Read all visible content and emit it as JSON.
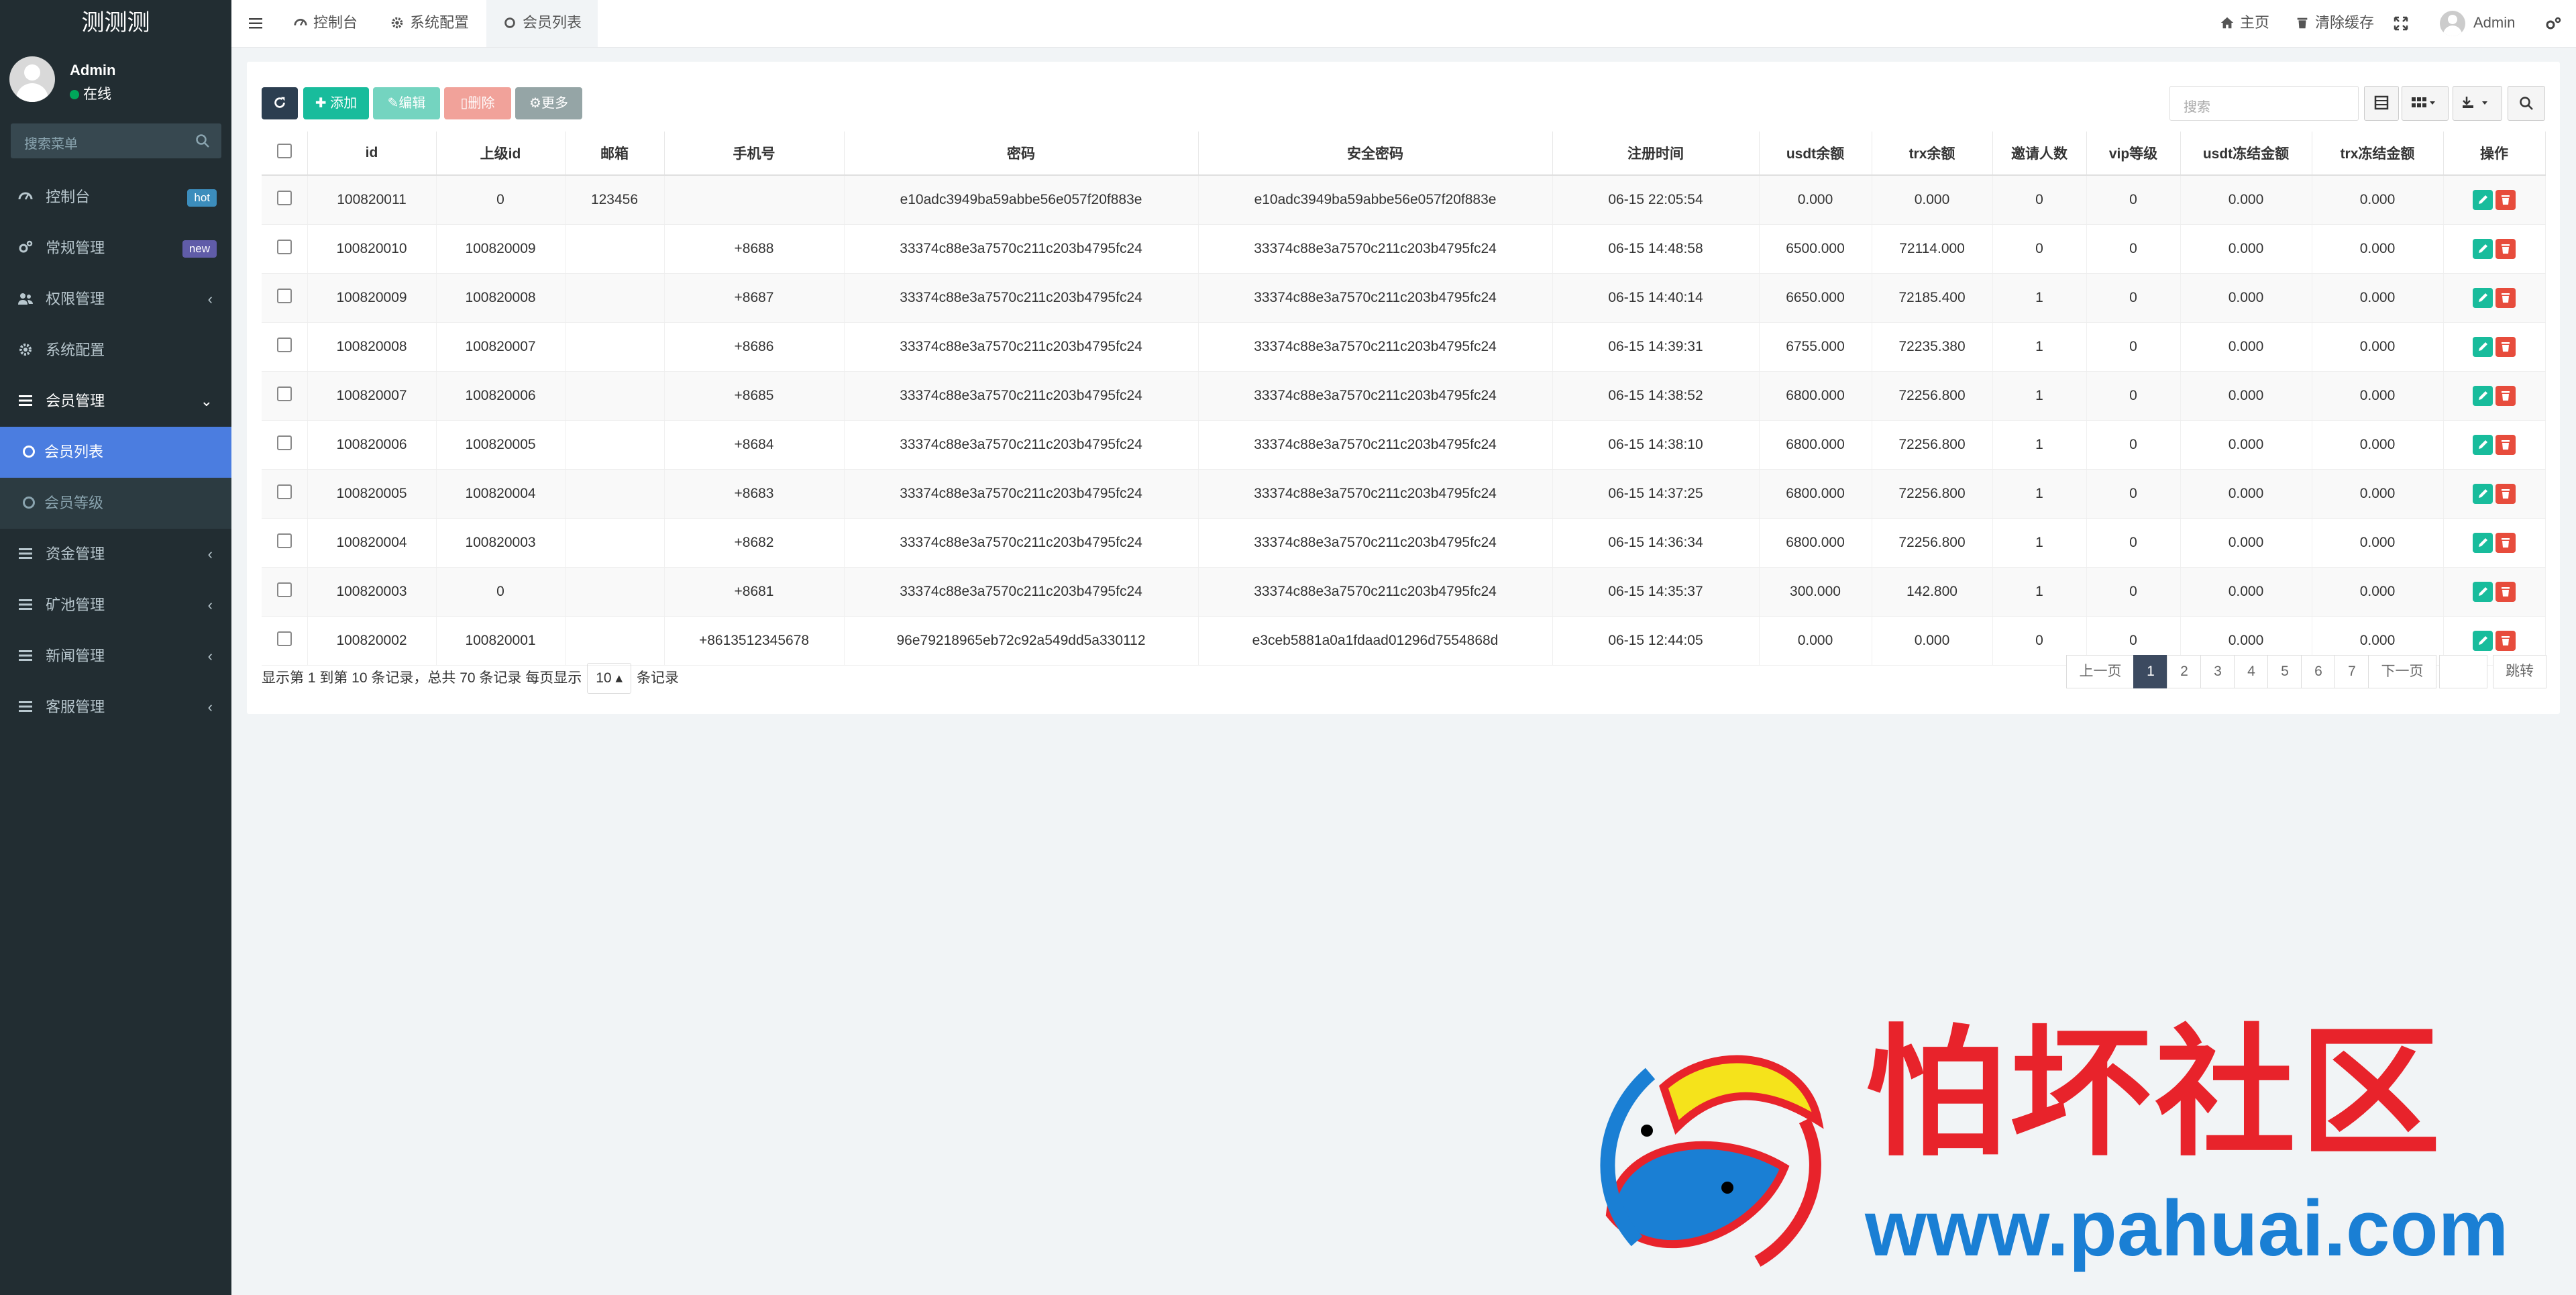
{
  "app": {
    "logo": "测测测"
  },
  "user": {
    "name": "Admin",
    "status": "在线"
  },
  "sidebar": {
    "search_placeholder": "搜索菜单",
    "items": [
      {
        "label": "控制台",
        "badge": "hot",
        "badge_color": "#3c8dbc"
      },
      {
        "label": "常规管理",
        "badge": "new",
        "badge_color": "#605ca8"
      },
      {
        "label": "权限管理"
      },
      {
        "label": "系统配置"
      },
      {
        "label": "会员管理"
      },
      {
        "label": "资金管理"
      },
      {
        "label": "矿池管理"
      },
      {
        "label": "新闻管理"
      },
      {
        "label": "客服管理"
      }
    ],
    "sub_items": [
      {
        "label": "会员列表"
      },
      {
        "label": "会员等级"
      }
    ]
  },
  "topbar": {
    "tabs": [
      {
        "label": "控制台"
      },
      {
        "label": "系统配置"
      },
      {
        "label": "会员列表"
      }
    ],
    "right": {
      "home": "主页",
      "clear_cache": "清除缓存",
      "user": "Admin"
    }
  },
  "toolbar": {
    "add": "添加",
    "edit": "编辑",
    "delete": "删除",
    "more": "更多",
    "search_placeholder": "搜索"
  },
  "table": {
    "headers": [
      "id",
      "上级id",
      "邮箱",
      "手机号",
      "密码",
      "安全密码",
      "注册时间",
      "usdt余额",
      "trx余额",
      "邀请人数",
      "vip等级",
      "usdt冻结金额",
      "trx冻结金额",
      "操作"
    ],
    "rows": [
      [
        "100820011",
        "0",
        "123456",
        "",
        "e10adc3949ba59abbe56e057f20f883e",
        "e10adc3949ba59abbe56e057f20f883e",
        "06-15 22:05:54",
        "0.000",
        "0.000",
        "0",
        "0",
        "0.000",
        "0.000"
      ],
      [
        "100820010",
        "100820009",
        "",
        "+8688",
        "33374c88e3a7570c211c203b4795fc24",
        "33374c88e3a7570c211c203b4795fc24",
        "06-15 14:48:58",
        "6500.000",
        "72114.000",
        "0",
        "0",
        "0.000",
        "0.000"
      ],
      [
        "100820009",
        "100820008",
        "",
        "+8687",
        "33374c88e3a7570c211c203b4795fc24",
        "33374c88e3a7570c211c203b4795fc24",
        "06-15 14:40:14",
        "6650.000",
        "72185.400",
        "1",
        "0",
        "0.000",
        "0.000"
      ],
      [
        "100820008",
        "100820007",
        "",
        "+8686",
        "33374c88e3a7570c211c203b4795fc24",
        "33374c88e3a7570c211c203b4795fc24",
        "06-15 14:39:31",
        "6755.000",
        "72235.380",
        "1",
        "0",
        "0.000",
        "0.000"
      ],
      [
        "100820007",
        "100820006",
        "",
        "+8685",
        "33374c88e3a7570c211c203b4795fc24",
        "33374c88e3a7570c211c203b4795fc24",
        "06-15 14:38:52",
        "6800.000",
        "72256.800",
        "1",
        "0",
        "0.000",
        "0.000"
      ],
      [
        "100820006",
        "100820005",
        "",
        "+8684",
        "33374c88e3a7570c211c203b4795fc24",
        "33374c88e3a7570c211c203b4795fc24",
        "06-15 14:38:10",
        "6800.000",
        "72256.800",
        "1",
        "0",
        "0.000",
        "0.000"
      ],
      [
        "100820005",
        "100820004",
        "",
        "+8683",
        "33374c88e3a7570c211c203b4795fc24",
        "33374c88e3a7570c211c203b4795fc24",
        "06-15 14:37:25",
        "6800.000",
        "72256.800",
        "1",
        "0",
        "0.000",
        "0.000"
      ],
      [
        "100820004",
        "100820003",
        "",
        "+8682",
        "33374c88e3a7570c211c203b4795fc24",
        "33374c88e3a7570c211c203b4795fc24",
        "06-15 14:36:34",
        "6800.000",
        "72256.800",
        "1",
        "0",
        "0.000",
        "0.000"
      ],
      [
        "100820003",
        "0",
        "",
        "+8681",
        "33374c88e3a7570c211c203b4795fc24",
        "33374c88e3a7570c211c203b4795fc24",
        "06-15 14:35:37",
        "300.000",
        "142.800",
        "1",
        "0",
        "0.000",
        "0.000"
      ],
      [
        "100820002",
        "100820001",
        "",
        "+8613512345678",
        "96e79218965eb72c92a549dd5a330112",
        "e3ceb5881a0a1fdaad01296d7554868d",
        "06-15 12:44:05",
        "0.000",
        "0.000",
        "0",
        "0",
        "0.000",
        "0.000"
      ]
    ]
  },
  "footer": {
    "summary": "显示第 1 到第 10 条记录，总共 70 条记录 每页显示",
    "page_size": "10",
    "suffix": "条记录"
  },
  "pagination": {
    "prev": "上一页",
    "pages": [
      "1",
      "2",
      "3",
      "4",
      "5",
      "6",
      "7"
    ],
    "next": "下一页",
    "go": "跳转"
  },
  "watermark": {
    "cn": "怕坏社区",
    "url": "www.pahuai.com"
  },
  "colors": {
    "sidebar_bg": "#222d32",
    "accent": "#4b7de0",
    "success": "#18bc9c",
    "danger": "#e74c3c",
    "watermark_red": "#e8232b",
    "watermark_blue": "#1a7fd4"
  }
}
